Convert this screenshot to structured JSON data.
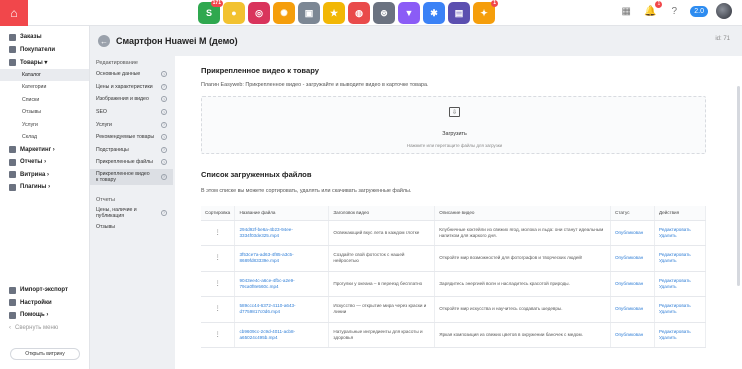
{
  "topbar": {
    "apps": [
      {
        "name": "s-app-icon",
        "bg": "#2fa84f",
        "glyph": "S",
        "badge": "171"
      },
      {
        "name": "coin-app-icon",
        "bg": "#f2c230",
        "glyph": "●"
      },
      {
        "name": "target-app-icon",
        "bg": "#d9345c",
        "glyph": "◎"
      },
      {
        "name": "color-wheel-app-icon",
        "bg": "#f59e0b",
        "glyph": "✺"
      },
      {
        "name": "window-app-icon",
        "bg": "#7c8794",
        "glyph": "▣"
      },
      {
        "name": "star-app-icon",
        "bg": "#f2b705",
        "glyph": "★"
      },
      {
        "name": "lifebuoy-app-icon",
        "bg": "#e94b4b",
        "glyph": "◍"
      },
      {
        "name": "steering-app-icon",
        "bg": "#6b7280",
        "glyph": "⊛"
      },
      {
        "name": "chart-app-icon",
        "bg": "#8b5cf6",
        "glyph": "▼"
      },
      {
        "name": "snowflake-app-icon",
        "bg": "#3b82f6",
        "glyph": "✱"
      },
      {
        "name": "tv-app-icon",
        "bg": "#5b4fb0",
        "glyph": "▤"
      },
      {
        "name": "wand-app-icon",
        "bg": "#f59e0b",
        "glyph": "✦",
        "badge": "1"
      }
    ],
    "notifications_badge": "1",
    "version": "2.0"
  },
  "sidebar": {
    "items": [
      {
        "label": "Заказы"
      },
      {
        "label": "Покупатели"
      },
      {
        "label": "Товары ▾"
      }
    ],
    "subitems": [
      "Каталог",
      "Категории",
      "Списки",
      "Отзывы",
      "Услуги",
      "Склад"
    ],
    "items2": [
      {
        "label": "Маркетинг ›"
      },
      {
        "label": "Отчеты ›"
      },
      {
        "label": "Витрина ›"
      },
      {
        "label": "Плагины ›"
      }
    ],
    "bottom": [
      {
        "label": "Импорт-экспорт"
      },
      {
        "label": "Настройки"
      },
      {
        "label": "Помощь ›"
      },
      {
        "label": "Свернуть меню"
      }
    ],
    "storefront_button": "Открыть витрину"
  },
  "header": {
    "title": "Смартфон Huawei M (демо)",
    "id_label": "id: 71"
  },
  "leftmenu": {
    "heading": "Редактирование",
    "items": [
      "Основные данные",
      "Цены и характеристики",
      "Изображения и видео",
      "SEO",
      "Услуги",
      "Рекомендуемые товары",
      "Подстраницы",
      "Прикрепленные файлы",
      "Прикрепленное видео к товару"
    ],
    "heading2": "Отчеты",
    "items2": [
      "Цены, наличие и публикация",
      "Отзывы"
    ]
  },
  "panel": {
    "title": "Прикрепленное видео к товару",
    "description": "Плагин Easyweb: Прикрепленное видео - загружайте и выводите видео в карточке товара.",
    "upload_label": "Загрузить",
    "upload_hint": "Нажмите или перетащите файлы для загрузки",
    "list_title": "Список загруженных файлов",
    "list_description": "В этом списке вы можете сортировать, удалять или скачивать загруженные файлы.",
    "columns": [
      "Сортировка",
      "Название файла",
      "Заголовок видео",
      "Описание видео",
      "Статус",
      "Действия"
    ],
    "rows": [
      {
        "file": "294d92f-be6a-4b23-94ee-3334f03de325.mp4",
        "title": "Освежающий вкус лета в каждом глотке",
        "desc": "Клубничные коктейли из свежих ягод, молока и льда: они станут идеальным напитком для жаркого дня.",
        "status": "Опубликован",
        "edit": "Редактировать",
        "del": "Удалить"
      },
      {
        "file": "3f53ce7a-ad63-4f85-a3c5-8689fd83339e.mp4",
        "title": "Создайте свой фотосток с нашей нейросетью",
        "desc": "Откройте мир возможностей для фотографов и творческих людей!",
        "status": "Опубликован",
        "edit": "Редактировать",
        "del": "Удалить"
      },
      {
        "file": "9043ee4c-a6ce-4fbc-a2e9-79ca0f8e560c.mp4",
        "title": "Прогулки у океана – в переезд бесплатно",
        "desc": "Зарядитесь энергией волн и насладитесь красотой природы.",
        "status": "Опубликован",
        "edit": "Редактировать",
        "del": "Удалить"
      },
      {
        "file": "589ccc44-6372-4110-a643-d7759817c0d6.mp4",
        "title": "Искусство — открытие мира через краски и линии",
        "desc": "Откройте мир искусства и научитесь создавать шедевры.",
        "status": "Опубликован",
        "edit": "Редактировать",
        "del": "Удалить"
      },
      {
        "file": "cb9609cc-2c9d-4011-acb8-a65024c495b.mp4",
        "title": "Натуральные ингредиенты для красоты и здоровья",
        "desc": "Яркая композиция из свежих цветов в окружении баночек с медом.",
        "status": "Опубликован",
        "edit": "Редактировать",
        "del": "Удалить"
      }
    ]
  }
}
